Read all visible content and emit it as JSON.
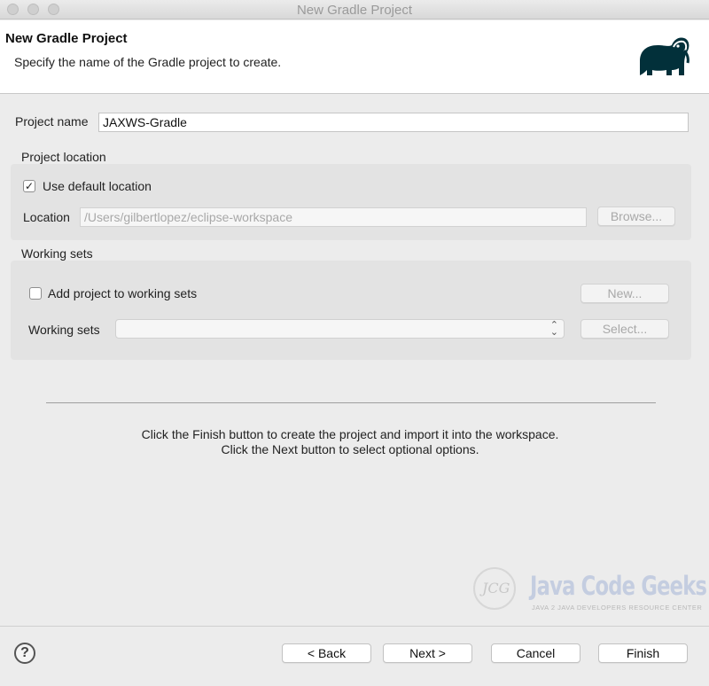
{
  "window": {
    "title": "New Gradle Project"
  },
  "header": {
    "title": "New Gradle Project",
    "description": "Specify the name of the Gradle project to create."
  },
  "project_name": {
    "label": "Project name",
    "value": "JAXWS-Gradle"
  },
  "project_location": {
    "group_label": "Project location",
    "use_default_label": "Use default location",
    "use_default_checked": true,
    "location_label": "Location",
    "location_value": "/Users/gilbertlopez/eclipse-workspace",
    "browse_label": "Browse..."
  },
  "working_sets": {
    "group_label": "Working sets",
    "add_label": "Add project to working sets",
    "add_checked": false,
    "new_label": "New...",
    "sets_label": "Working sets",
    "select_label": "Select..."
  },
  "info_text": "Click the Finish button to create the project and import it into the workspace. Click the Next button to select optional options.",
  "watermark": {
    "name": "Java Code Geeks",
    "tagline": "JAVA 2 JAVA DEVELOPERS RESOURCE CENTER",
    "mark": "JCG"
  },
  "footer": {
    "help": "?",
    "back": "< Back",
    "next": "Next >",
    "cancel": "Cancel",
    "finish": "Finish"
  },
  "colors": {
    "gradle_logo": "#02303a"
  }
}
